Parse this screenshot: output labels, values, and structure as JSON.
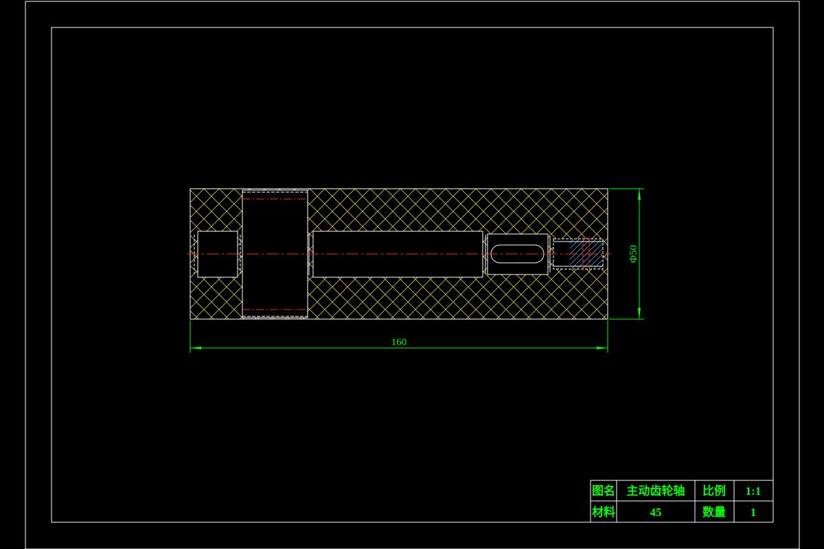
{
  "drawing": {
    "dimensions": {
      "overall_length": "160",
      "diameter": "Φ50"
    },
    "title_block": {
      "name_label": "图名",
      "name_value": "主动齿轮轴",
      "scale_label": "比例",
      "scale_value": "1:1",
      "material_label": "材料",
      "material_value": "45",
      "quantity_label": "数量",
      "quantity_value": "1"
    },
    "colors": {
      "background": "#000000",
      "border": "#ffffff",
      "outline": "#ffffff",
      "hatch": "#d4c84a",
      "centerline": "#ff2020",
      "dimension": "#00ff00",
      "title_text": "#00ff00"
    }
  }
}
